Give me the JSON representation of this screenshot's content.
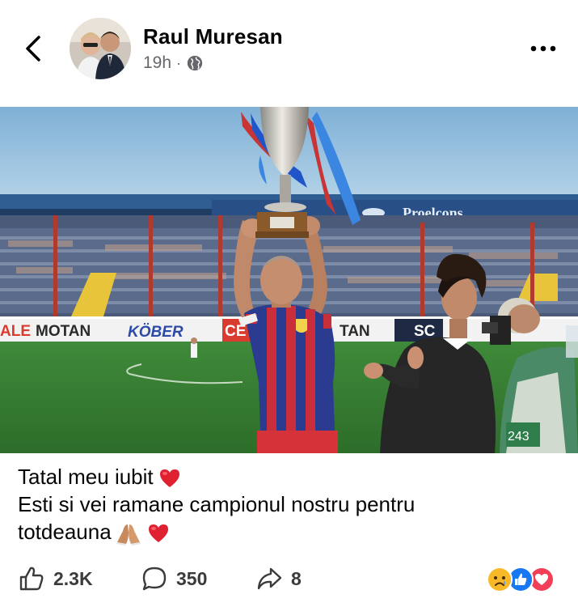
{
  "post": {
    "author": "Raul Muresan",
    "time": "19h",
    "separator": "·",
    "privacy_icon": "globe-icon"
  },
  "photo": {
    "banner_text": "Proelcons",
    "ad_boards": [
      "ALE",
      "MOTAN",
      "KÖBER",
      "CE",
      "TAN",
      "SC"
    ],
    "cameraman_bib": "243"
  },
  "caption": {
    "line1": "Tatal meu iubit",
    "line2": "Esti si vei ramane campionul nostru pentru",
    "line3": "totdeauna"
  },
  "stats": {
    "likes": "2.3K",
    "comments": "350",
    "shares": "8"
  },
  "reactions": [
    "sad-reaction-icon",
    "like-reaction-icon",
    "love-reaction-icon"
  ],
  "colors": {
    "like_blue": "#1877f2",
    "love_red": "#f33e58",
    "sad_yellow": "#f7b928",
    "meta_gray": "#65676b"
  }
}
